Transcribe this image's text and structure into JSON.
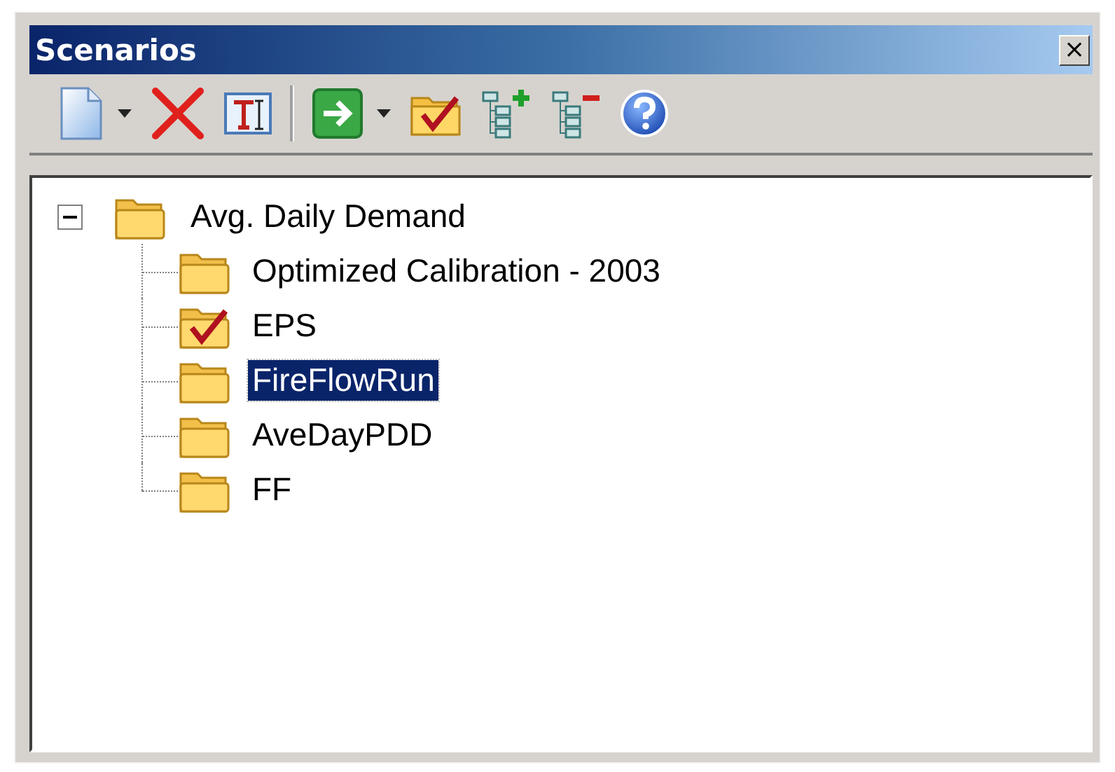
{
  "window": {
    "title": "Scenarios",
    "close": "×"
  },
  "tree": {
    "label": "Avg. Daily Demand",
    "expanded": true,
    "selected": false,
    "checked": false,
    "children": [
      {
        "label": "Optimized Calibration - 2003",
        "checked": false,
        "selected": false
      },
      {
        "label": "EPS",
        "checked": true,
        "selected": false
      },
      {
        "label": "FireFlowRun",
        "checked": false,
        "selected": true
      },
      {
        "label": "AveDayPDD",
        "checked": false,
        "selected": false
      },
      {
        "label": "FF",
        "checked": false,
        "selected": false
      }
    ]
  }
}
